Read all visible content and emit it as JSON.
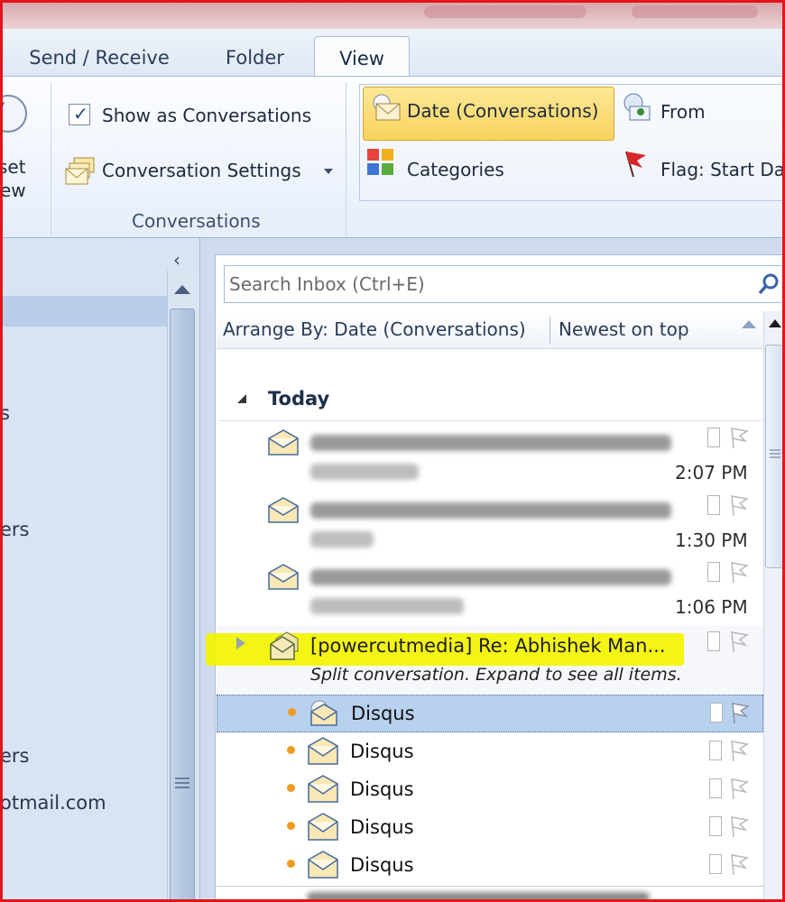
{
  "window": {
    "accent": "#e1141c"
  },
  "tabs": [
    {
      "label": "Send / Receive"
    },
    {
      "label": "Folder"
    },
    {
      "label": "View",
      "active": true
    }
  ],
  "ribbon": {
    "reset_view_label_1": "set",
    "reset_view_label_2": "ew",
    "show_as_conversations": {
      "label": "Show as Conversations",
      "checked": true
    },
    "conversation_settings_label": "Conversation Settings",
    "conversations_group_label": "Conversations",
    "arrangement": {
      "date_conversations": "Date (Conversations)",
      "from": "From",
      "categories": "Categories",
      "flag_start_date": "Flag: Start Da"
    }
  },
  "nav": {
    "items": [
      {
        "label": "s"
      },
      {
        "label": "ers"
      },
      {
        "label": "ers"
      },
      {
        "label": "otmail.com"
      }
    ]
  },
  "mail": {
    "search_placeholder": "Search Inbox (Ctrl+E)",
    "arrange_by": "Arrange By: Date (Conversations)",
    "sort_order": "Newest on top",
    "group_header": "Today",
    "messages": [
      {
        "time": "2:07 PM"
      },
      {
        "time": "1:30 PM"
      },
      {
        "time": "1:06 PM"
      }
    ],
    "conversation": {
      "subject": "[powercutmedia] Re: Abhishek Man...",
      "note": "Split conversation. Expand to see all items.",
      "items": [
        {
          "sender": "Disqus",
          "selected": true
        },
        {
          "sender": "Disqus"
        },
        {
          "sender": "Disqus"
        },
        {
          "sender": "Disqus"
        },
        {
          "sender": "Disqus"
        }
      ]
    }
  }
}
